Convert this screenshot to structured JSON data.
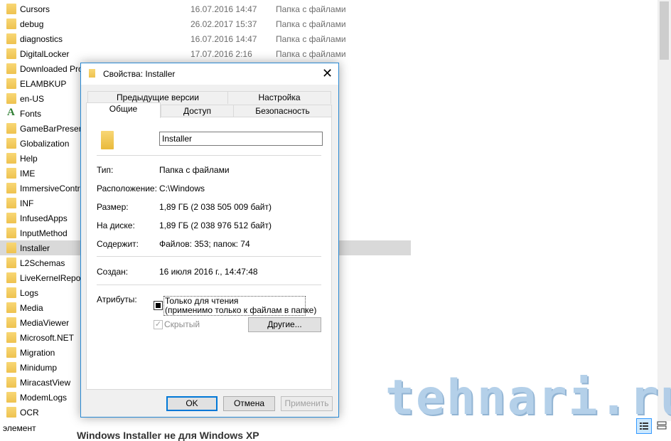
{
  "files": [
    {
      "name": "Cursors",
      "date": "16.07.2016 14:47",
      "type": "Папка с файлами",
      "icon": "folder-icon"
    },
    {
      "name": "debug",
      "date": "26.02.2017 15:37",
      "type": "Папка с файлами",
      "icon": "folder-icon"
    },
    {
      "name": "diagnostics",
      "date": "16.07.2016 14:47",
      "type": "Папка с файлами",
      "icon": "folder-icon"
    },
    {
      "name": "DigitalLocker",
      "date": "17.07.2016 2:16",
      "type": "Папка с файлами",
      "icon": "folder-icon"
    },
    {
      "name": "Downloaded Pro",
      "date": "",
      "type": "",
      "icon": "folder-icon"
    },
    {
      "name": "ELAMBKUP",
      "date": "",
      "type": "",
      "icon": "folder-icon"
    },
    {
      "name": "en-US",
      "date": "",
      "type": "",
      "icon": "folder-icon"
    },
    {
      "name": "Fonts",
      "date": "",
      "type": "",
      "icon": "font-icon"
    },
    {
      "name": "GameBarPresence",
      "date": "",
      "type": "",
      "icon": "folder-icon"
    },
    {
      "name": "Globalization",
      "date": "",
      "type": "",
      "icon": "folder-icon"
    },
    {
      "name": "Help",
      "date": "",
      "type": "",
      "icon": "folder-icon"
    },
    {
      "name": "IME",
      "date": "",
      "type": "",
      "icon": "folder-icon"
    },
    {
      "name": "ImmersiveContr",
      "date": "",
      "type": "",
      "icon": "folder-icon"
    },
    {
      "name": "INF",
      "date": "",
      "type": "",
      "icon": "folder-icon"
    },
    {
      "name": "InfusedApps",
      "date": "",
      "type": "",
      "icon": "folder-icon"
    },
    {
      "name": "InputMethod",
      "date": "",
      "type": "",
      "icon": "folder-icon"
    },
    {
      "name": "Installer",
      "date": "",
      "type": "",
      "icon": "folder-icon",
      "selected": true
    },
    {
      "name": "L2Schemas",
      "date": "",
      "type": "",
      "icon": "folder-icon"
    },
    {
      "name": "LiveKernelRepor",
      "date": "",
      "type": "",
      "icon": "folder-icon"
    },
    {
      "name": "Logs",
      "date": "",
      "type": "",
      "icon": "folder-icon"
    },
    {
      "name": "Media",
      "date": "",
      "type": "",
      "icon": "folder-icon"
    },
    {
      "name": "MediaViewer",
      "date": "",
      "type": "",
      "icon": "folder-icon"
    },
    {
      "name": "Microsoft.NET",
      "date": "",
      "type": "",
      "icon": "folder-icon"
    },
    {
      "name": "Migration",
      "date": "",
      "type": "",
      "icon": "folder-icon"
    },
    {
      "name": "Minidump",
      "date": "",
      "type": "",
      "icon": "folder-icon"
    },
    {
      "name": "MiracastView",
      "date": "",
      "type": "",
      "icon": "folder-icon"
    },
    {
      "name": "ModemLogs",
      "date": "",
      "type": "",
      "icon": "folder-icon"
    },
    {
      "name": "OCR",
      "date": "",
      "type": "",
      "icon": "folder-icon"
    }
  ],
  "status": {
    "text": "элемент",
    "behind_text": "Windows Installer не для Windows XP"
  },
  "watermark": "tehnari.ru",
  "dialog": {
    "title": "Свойства: Installer",
    "close_glyph": "✕",
    "tabs": {
      "previous_versions": "Предыдущие версии",
      "customize": "Настройка",
      "general": "Общие",
      "sharing": "Доступ",
      "security": "Безопасность"
    },
    "name_value": "Installer",
    "props": {
      "type_label": "Тип:",
      "type_value": "Папка с файлами",
      "location_label": "Расположение:",
      "location_value": "C:\\Windows",
      "size_label": "Размер:",
      "size_value": "1,89 ГБ (2 038 505 009 байт)",
      "disk_label": "На диске:",
      "disk_value": "1,89 ГБ (2 038 976 512 байт)",
      "contains_label": "Содержит:",
      "contains_value": "Файлов: 353; папок: 74",
      "created_label": "Создан:",
      "created_value": "16 июля 2016 г., 14:47:48",
      "attributes_label": "Атрибуты:"
    },
    "readonly_line1": "Только для чтения",
    "readonly_line2": "(применимо только к файлам в папке)",
    "hidden_label": "Скрытый",
    "advanced_button": "Другие...",
    "ok_button": "OK",
    "cancel_button": "Отмена",
    "apply_button": "Применить"
  }
}
